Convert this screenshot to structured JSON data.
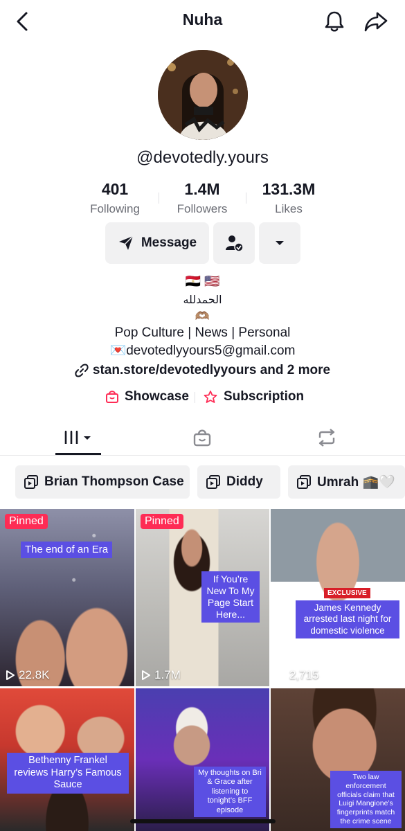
{
  "header": {
    "title": "Nuha",
    "back_icon": "chevron-left-icon",
    "bell_icon": "bell-icon",
    "share_icon": "share-arrow-icon"
  },
  "profile": {
    "handle": "@devotedly.yours",
    "stats": [
      {
        "value": "401",
        "label": "Following"
      },
      {
        "value": "1.4M",
        "label": "Followers"
      },
      {
        "value": "131.3M",
        "label": "Likes"
      }
    ],
    "message_label": "Message"
  },
  "bio": {
    "flags": "🇪🇬 🇺🇸",
    "arabic": "الحمدلله",
    "hands": "🫶🏽",
    "line1": "Pop Culture | News | Personal",
    "line2": "💌devotedlyyours5@gmail.com",
    "link": "stan.store/devotedlyyours and 2 more"
  },
  "features": {
    "showcase": "Showcase",
    "subscription": "Subscription"
  },
  "playlists": [
    {
      "label": "Brian Thompson Case"
    },
    {
      "label": "Diddy"
    },
    {
      "label": "Umrah 🕋🤍"
    }
  ],
  "videos": [
    {
      "pinned": "Pinned",
      "caption": "The end of an Era",
      "views": "22.8K"
    },
    {
      "pinned": "Pinned",
      "caption": "If You’re New To My Page Start Here...",
      "views": "1.7M"
    },
    {
      "tag": "EXCLUSIVE",
      "caption": "James Kennedy arrested last night for domestic violence",
      "views": "2,715"
    },
    {
      "caption": "Bethenny Frankel reviews Harry’s Famous Sauce"
    },
    {
      "caption": "My thoughts on Bri & Grace after listening to tonight’s BFF episode"
    },
    {
      "caption": "Two law enforcement officials claim that Luigi Mangione’s fingerprints match the crime scene"
    }
  ],
  "colors": {
    "accent_red": "#fe2c55",
    "caption_purple": "#5b4fe3",
    "chip_bg": "#f1f1f2",
    "text_primary": "#161823",
    "text_secondary": "#6b6d75"
  }
}
